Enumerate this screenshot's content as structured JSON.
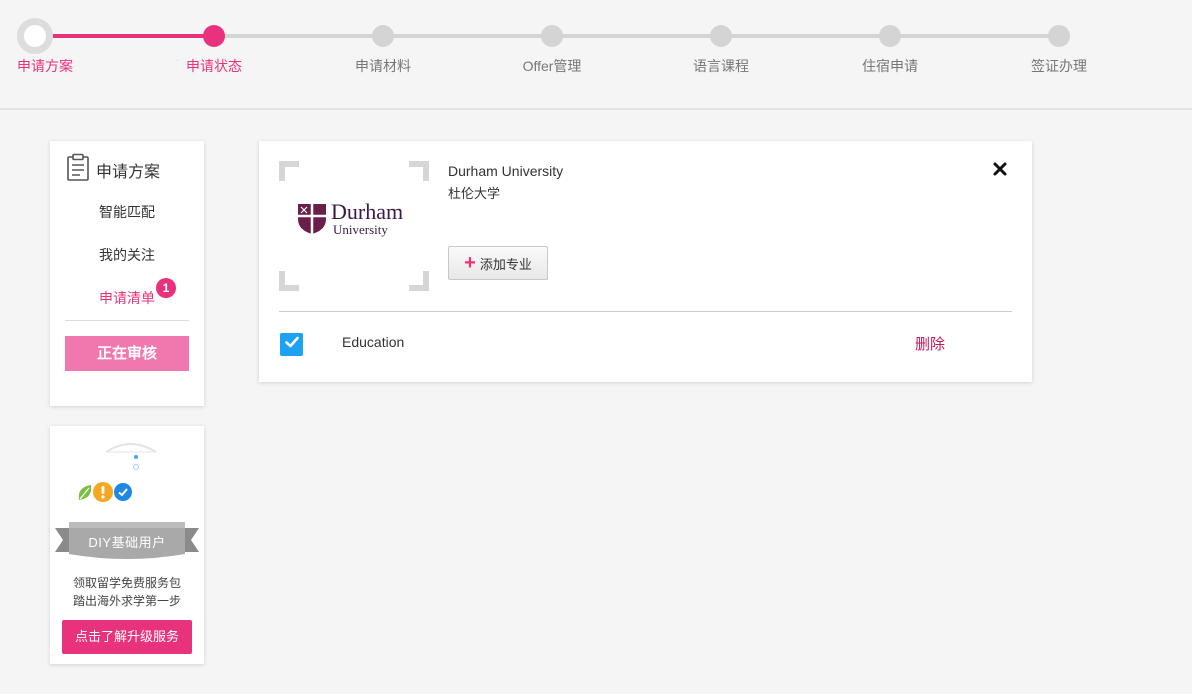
{
  "stepper": {
    "steps": [
      {
        "label": "申请方案"
      },
      {
        "label": "申请状态"
      },
      {
        "label": "申请材料"
      },
      {
        "label": "Offer管理"
      },
      {
        "label": "语言课程"
      },
      {
        "label": "住宿申请"
      },
      {
        "label": "签证办理"
      }
    ],
    "progress_fraction": 0.1667
  },
  "sidebar": {
    "title": "申请方案",
    "items": [
      {
        "label": "智能匹配"
      },
      {
        "label": "我的关注"
      },
      {
        "label": "申请清单",
        "badge": "1"
      }
    ],
    "review_button": "正在审核"
  },
  "promo": {
    "ribbon": "DIY基础用户",
    "line1": "领取留学免费服务包",
    "line2": "踏出海外求学第一步",
    "button": "点击了解升级服务"
  },
  "main": {
    "logo_word": "Durham",
    "logo_sub": "University",
    "university_en": "Durham University",
    "university_zh": "杜伦大学",
    "add_major_button": "添加专业",
    "major": "Education",
    "delete_link": "删除"
  },
  "colors": {
    "accent": "#e8327c",
    "review_button": "#f078ae",
    "checkbox": "#1da1f2",
    "delete": "#c2185b"
  }
}
